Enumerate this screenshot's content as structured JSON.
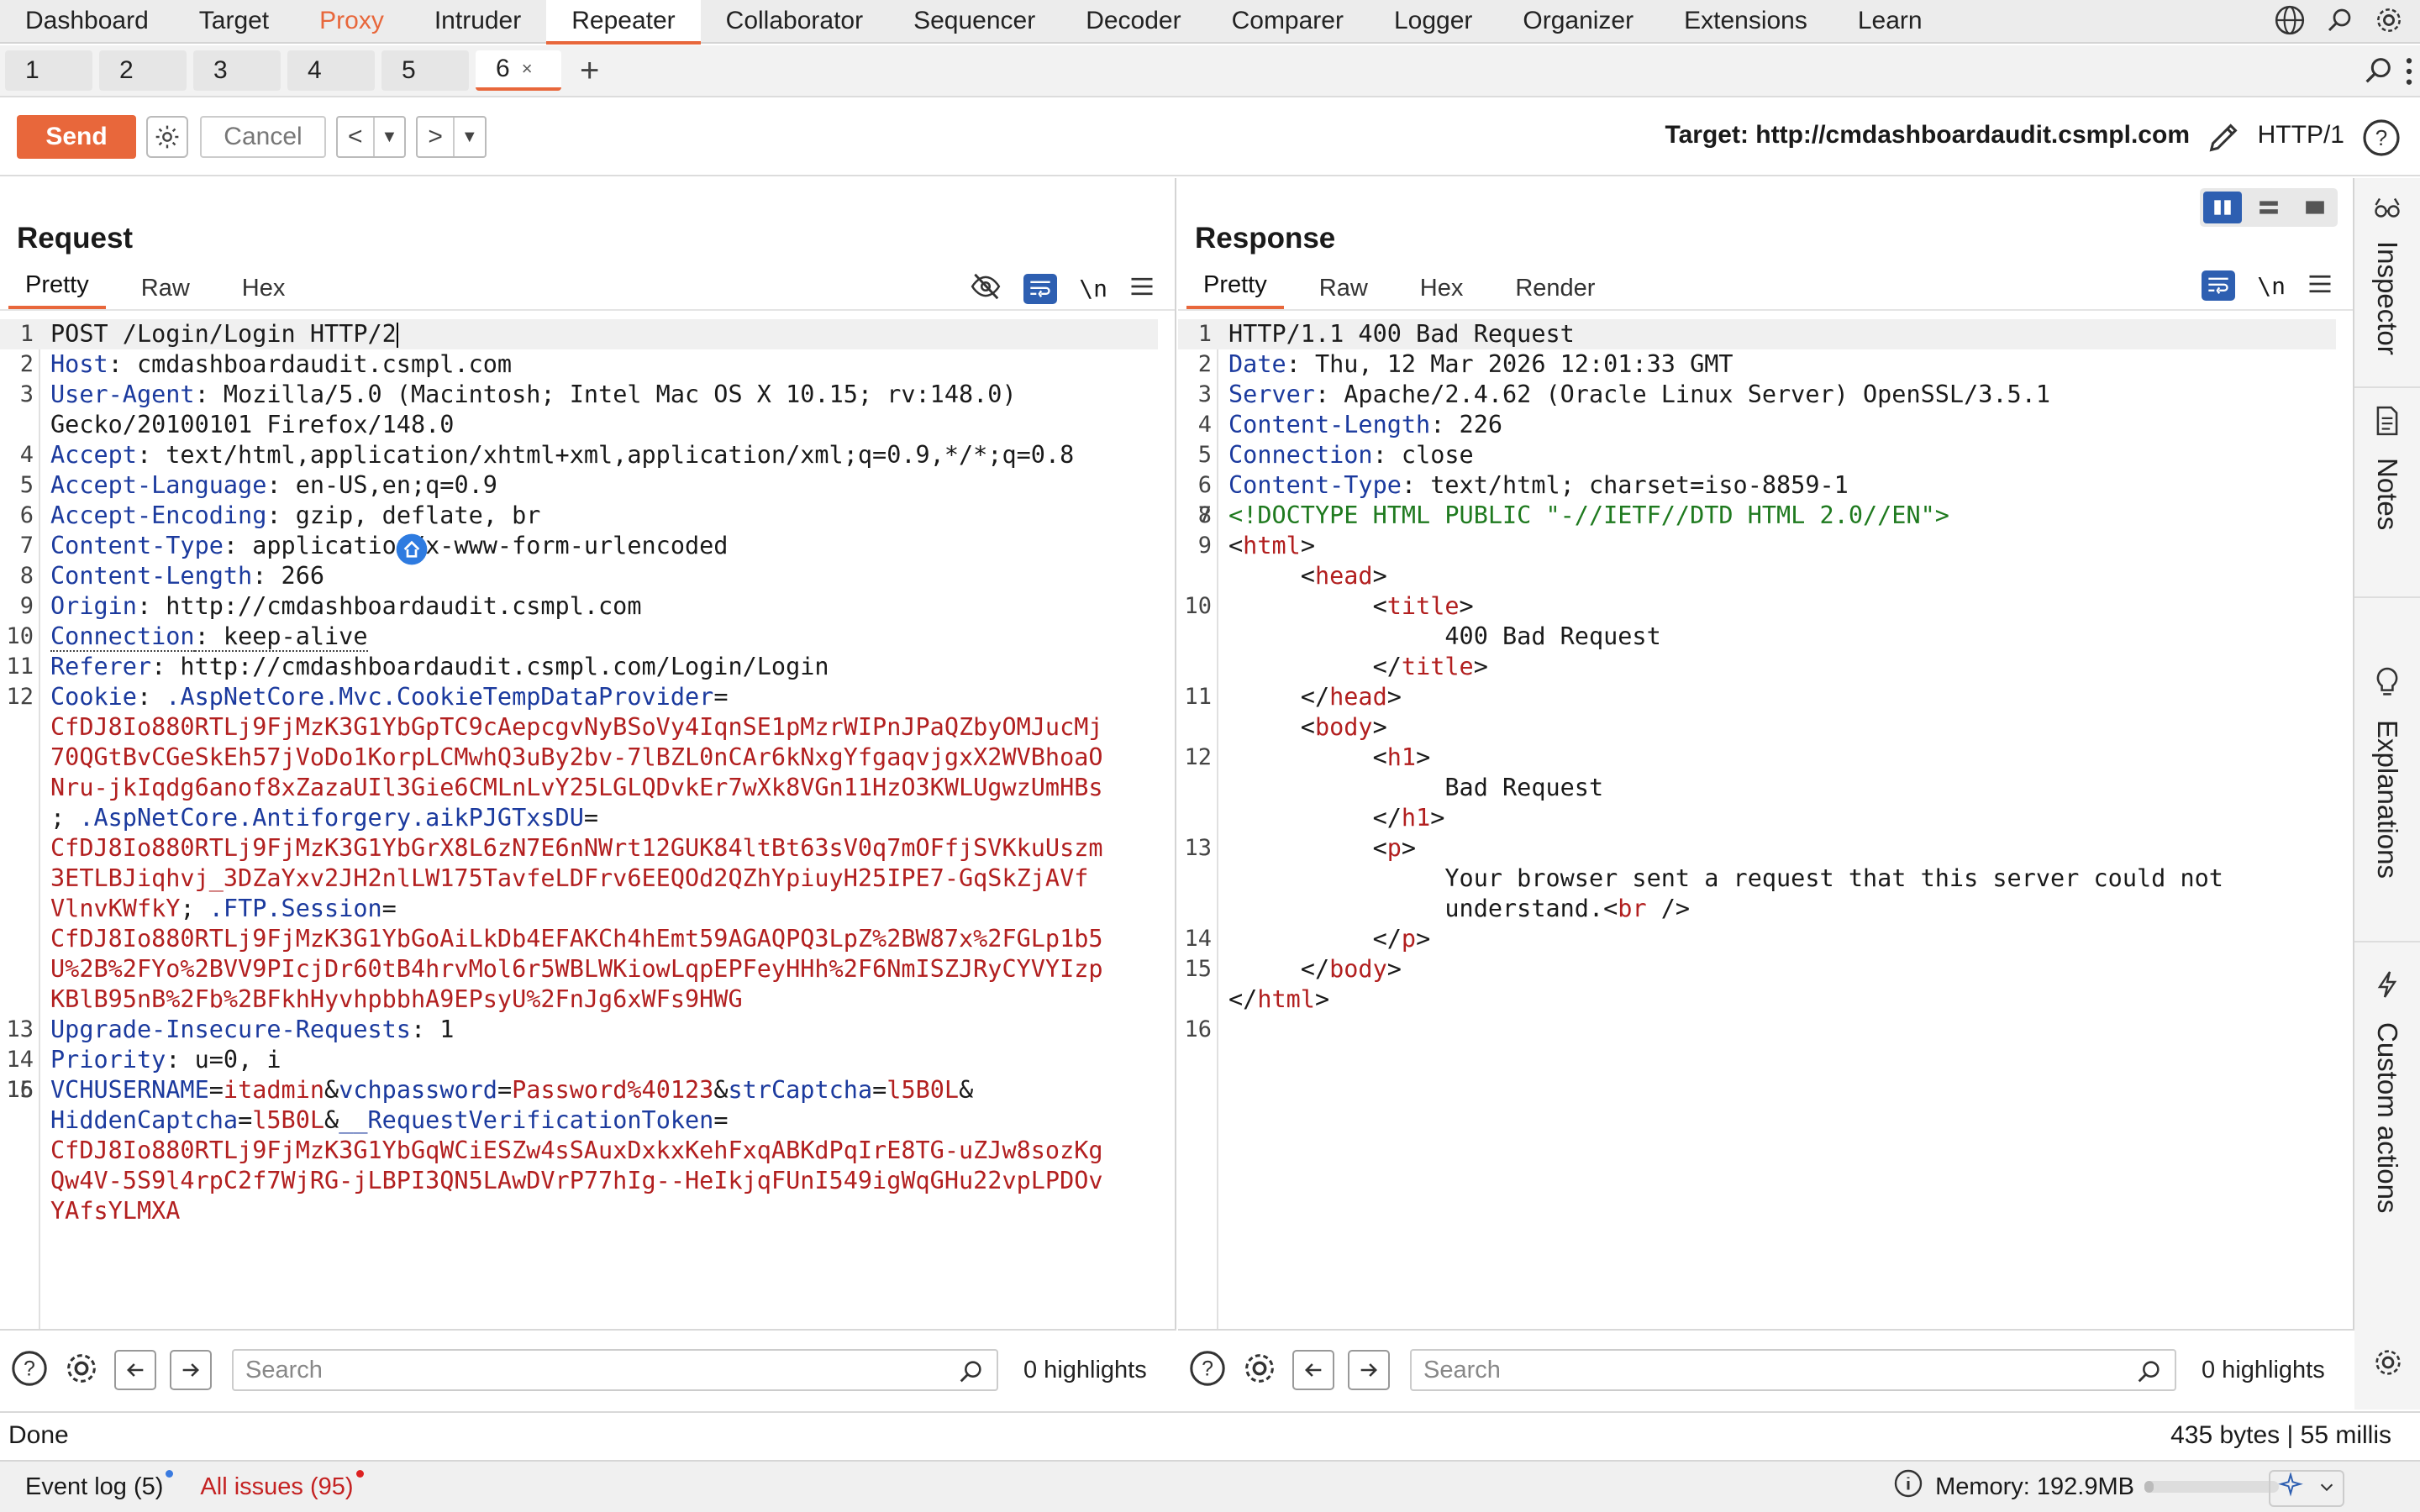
{
  "nav": {
    "tabs": [
      "Dashboard",
      "Target",
      "Proxy",
      "Intruder",
      "Repeater",
      "Collaborator",
      "Sequencer",
      "Decoder",
      "Comparer",
      "Logger",
      "Organizer",
      "Extensions",
      "Learn"
    ],
    "active": "Repeater"
  },
  "repeater_tabs": {
    "items": [
      "1",
      "2",
      "3",
      "4",
      "5",
      "6"
    ],
    "active": "6",
    "close_glyph": "×",
    "add_glyph": "+"
  },
  "toolbar": {
    "send": "Send",
    "cancel": "Cancel",
    "back": "<",
    "forward": ">",
    "target": "Target: http://cmdashboardaudit.csmpl.com",
    "protocol": "HTTP/1"
  },
  "request": {
    "title": "Request",
    "tabs": [
      "Pretty",
      "Raw",
      "Hex"
    ],
    "newline_toggle": "\\n",
    "lines": [
      {
        "n": "1",
        "segs": [
          [
            "",
            "POST /Login/Login HTTP/2"
          ]
        ]
      },
      {
        "n": "2",
        "segs": [
          [
            "hk",
            "Host"
          ],
          [
            "",
            ": cmdashboardaudit.csmpl.com"
          ]
        ]
      },
      {
        "n": "3",
        "segs": [
          [
            "hk",
            "User-Agent"
          ],
          [
            "",
            ": Mozilla/5.0 (Macintosh; Intel Mac OS X 10.15; rv:148.0)"
          ]
        ]
      },
      {
        "n": "",
        "segs": [
          [
            "",
            "Gecko/20100101 Firefox/148.0"
          ]
        ]
      },
      {
        "n": "4",
        "segs": [
          [
            "hk",
            "Accept"
          ],
          [
            "",
            ": text/html,application/xhtml+xml,application/xml;q=0.9,*/*;q=0.8"
          ]
        ]
      },
      {
        "n": "5",
        "segs": [
          [
            "hk",
            "Accept-Language"
          ],
          [
            "",
            ": en-US,en;q=0.9"
          ]
        ]
      },
      {
        "n": "6",
        "segs": [
          [
            "hk",
            "Accept-Encoding"
          ],
          [
            "",
            ": gzip, deflate, br"
          ]
        ]
      },
      {
        "n": "7",
        "segs": [
          [
            "hk",
            "Content-Type"
          ],
          [
            "",
            ": application/x-www-form-urlencoded"
          ]
        ]
      },
      {
        "n": "8",
        "segs": [
          [
            "hk",
            "Content-Length"
          ],
          [
            "",
            ": 266"
          ]
        ]
      },
      {
        "n": "9",
        "segs": [
          [
            "hk",
            "Origin"
          ],
          [
            "",
            ": http://cmdashboardaudit.csmpl.com"
          ]
        ]
      },
      {
        "n": "10",
        "segs": [
          [
            "hk dotted",
            "Connection"
          ],
          [
            "dotted",
            ": keep-alive"
          ]
        ]
      },
      {
        "n": "11",
        "segs": [
          [
            "hk",
            "Referer"
          ],
          [
            "",
            ": http://cmdashboardaudit.csmpl.com/Login/Login"
          ]
        ]
      },
      {
        "n": "12",
        "segs": [
          [
            "hk",
            "Cookie"
          ],
          [
            "",
            ": "
          ],
          [
            "blu",
            ".AspNetCore.Mvc.CookieTempDataProvider"
          ],
          [
            "",
            "="
          ]
        ]
      },
      {
        "n": "",
        "segs": [
          [
            "red",
            "CfDJ8Io880RTLj9FjMzK3G1YbGpTC9cAepcgvNyBSoVy4IqnSE1pMzrWIPnJPaQZbyOMJucMj"
          ]
        ]
      },
      {
        "n": "",
        "segs": [
          [
            "red",
            "70QGtBvCGeSkEh57jVoDo1KorpLCMwhQ3uBy2bv-7lBZL0nCAr6kNxgYfgaqvjgxX2WVBhoaO"
          ]
        ]
      },
      {
        "n": "",
        "segs": [
          [
            "red",
            "Nru-jkIqdg6anof8xZazaUIl3Gie6CMLnLvY25LGLQDvkEr7wXk8VGn11HzO3KWLUgwzUmHBs"
          ]
        ]
      },
      {
        "n": "",
        "segs": [
          [
            "",
            "; "
          ],
          [
            "blu",
            ".AspNetCore.Antiforgery.aikPJGTxsDU"
          ],
          [
            "",
            "="
          ]
        ]
      },
      {
        "n": "",
        "segs": [
          [
            "red",
            "CfDJ8Io880RTLj9FjMzK3G1YbGrX8L6zN7E6nNWrt12GUK84ltBt63sV0q7mOFfjSVKkuUszm"
          ]
        ]
      },
      {
        "n": "",
        "segs": [
          [
            "red",
            "3ETLBJiqhvj_3DZaYxv2JH2nlLW175TavfeLDFrv6EEQOd2QZhYpiuyH25IPE7-GqSkZjAVf"
          ]
        ]
      },
      {
        "n": "",
        "segs": [
          [
            "red",
            "VlnvKWfkY"
          ],
          [
            "",
            "; "
          ],
          [
            "blu",
            ".FTP.Session"
          ],
          [
            "",
            "="
          ]
        ]
      },
      {
        "n": "",
        "segs": [
          [
            "red",
            "CfDJ8Io880RTLj9FjMzK3G1YbGoAiLkDb4EFAKCh4hEmt59AGAQPQ3LpZ%2BW87x%2FGLp1b5"
          ]
        ]
      },
      {
        "n": "",
        "segs": [
          [
            "red",
            "U%2B%2FYo%2BVV9PIcjDr60tB4hrvMol6r5WBLWKiowLqpEPFeyHHh%2F6NmISZJRyCYVYIzp"
          ]
        ]
      },
      {
        "n": "",
        "segs": [
          [
            "red",
            "KBlB95nB%2Fb%2BFkhHyvhpbbhA9EPsyU%2FnJg6xWFs9HWG"
          ]
        ]
      },
      {
        "n": "13",
        "segs": [
          [
            "hk",
            "Upgrade-Insecure-Requests"
          ],
          [
            "",
            ": 1"
          ]
        ]
      },
      {
        "n": "14",
        "segs": [
          [
            "hk",
            "Priority"
          ],
          [
            "",
            ": u=0, i"
          ]
        ]
      },
      {
        "n": "15",
        "segs": [
          [
            "",
            ""
          ]
        ]
      },
      {
        "n": "16",
        "segs": [
          [
            "blu",
            "VCHUSERNAME"
          ],
          [
            "",
            "="
          ],
          [
            "red",
            "itadmin"
          ],
          [
            "",
            "&"
          ],
          [
            "blu",
            "vchpassword"
          ],
          [
            "",
            "="
          ],
          [
            "red",
            "Password%40123"
          ],
          [
            "",
            "&"
          ],
          [
            "blu",
            "strCaptcha"
          ],
          [
            "",
            "="
          ],
          [
            "red",
            "l5B0L"
          ],
          [
            "",
            "&"
          ]
        ]
      },
      {
        "n": "",
        "segs": [
          [
            "blu",
            "HiddenCaptcha"
          ],
          [
            "",
            "="
          ],
          [
            "red",
            "l5B0L"
          ],
          [
            "",
            "&"
          ],
          [
            "blu",
            "__RequestVerificationToken"
          ],
          [
            "",
            "="
          ]
        ]
      },
      {
        "n": "",
        "segs": [
          [
            "red",
            "CfDJ8Io880RTLj9FjMzK3G1YbGqWCiESZw4sSAuxDxkxKehFxqABKdPqIrE8TG-uZJw8sozKg"
          ]
        ]
      },
      {
        "n": "",
        "segs": [
          [
            "red",
            "Qw4V-5S9l4rpC2f7WjRG-jLBPI3QN5LAwDVrP77hIg--HeIkjqFUnI549igWqGHu22vpLPDOv"
          ]
        ]
      },
      {
        "n": "",
        "segs": [
          [
            "red",
            "YAfsYLMXA"
          ]
        ]
      }
    ],
    "search_placeholder": "Search",
    "highlights": "0 highlights"
  },
  "response": {
    "title": "Response",
    "tabs": [
      "Pretty",
      "Raw",
      "Hex",
      "Render"
    ],
    "newline_toggle": "\\n",
    "lines": [
      {
        "n": "1",
        "segs": [
          [
            "",
            "HTTP/1.1 400 Bad Request"
          ]
        ]
      },
      {
        "n": "2",
        "segs": [
          [
            "hk",
            "Date"
          ],
          [
            "",
            ": Thu, 12 Mar 2026 12:01:33 GMT"
          ]
        ]
      },
      {
        "n": "3",
        "segs": [
          [
            "hk",
            "Server"
          ],
          [
            "",
            ": Apache/2.4.62 (Oracle Linux Server) OpenSSL/3.5.1"
          ]
        ]
      },
      {
        "n": "4",
        "segs": [
          [
            "hk",
            "Content-Length"
          ],
          [
            "",
            ": 226"
          ]
        ]
      },
      {
        "n": "5",
        "segs": [
          [
            "hk",
            "Connection"
          ],
          [
            "",
            ": close"
          ]
        ]
      },
      {
        "n": "6",
        "segs": [
          [
            "hk",
            "Content-Type"
          ],
          [
            "",
            ": text/html; charset=iso-8859-1"
          ]
        ]
      },
      {
        "n": "7",
        "segs": [
          [
            "",
            ""
          ]
        ]
      },
      {
        "n": "8",
        "segs": [
          [
            "grn",
            "<!DOCTYPE HTML PUBLIC \"-//IETF//DTD HTML 2.0//EN\">"
          ]
        ]
      },
      {
        "n": "9",
        "segs": [
          [
            "",
            "<"
          ],
          [
            "tag",
            "html"
          ],
          [
            "",
            ">"
          ]
        ]
      },
      {
        "n": "",
        "segs": [
          [
            "",
            "     <"
          ],
          [
            "tag",
            "head"
          ],
          [
            "",
            ">"
          ]
        ]
      },
      {
        "n": "10",
        "segs": [
          [
            "",
            "          <"
          ],
          [
            "tag",
            "title"
          ],
          [
            "",
            ">"
          ]
        ]
      },
      {
        "n": "",
        "segs": [
          [
            "",
            "               400 Bad Request"
          ]
        ]
      },
      {
        "n": "",
        "segs": [
          [
            "",
            "          </"
          ],
          [
            "tag",
            "title"
          ],
          [
            "",
            ">"
          ]
        ]
      },
      {
        "n": "11",
        "segs": [
          [
            "",
            "     </"
          ],
          [
            "tag",
            "head"
          ],
          [
            "",
            ">"
          ]
        ]
      },
      {
        "n": "",
        "segs": [
          [
            "",
            "     <"
          ],
          [
            "tag",
            "body"
          ],
          [
            "",
            ">"
          ]
        ]
      },
      {
        "n": "12",
        "segs": [
          [
            "",
            "          <"
          ],
          [
            "tag",
            "h1"
          ],
          [
            "",
            ">"
          ]
        ]
      },
      {
        "n": "",
        "segs": [
          [
            "",
            "               Bad Request"
          ]
        ]
      },
      {
        "n": "",
        "segs": [
          [
            "",
            "          </"
          ],
          [
            "tag",
            "h1"
          ],
          [
            "",
            ">"
          ]
        ]
      },
      {
        "n": "13",
        "segs": [
          [
            "",
            "          <"
          ],
          [
            "tag",
            "p"
          ],
          [
            "",
            ">"
          ]
        ]
      },
      {
        "n": "",
        "segs": [
          [
            "",
            "               Your browser sent a request that this server could not"
          ]
        ]
      },
      {
        "n": "",
        "segs": [
          [
            "",
            "               understand.<"
          ],
          [
            "tag",
            "br"
          ],
          [
            "",
            " />"
          ]
        ]
      },
      {
        "n": "14",
        "segs": [
          [
            "",
            "          </"
          ],
          [
            "tag",
            "p"
          ],
          [
            "",
            ">"
          ]
        ]
      },
      {
        "n": "15",
        "segs": [
          [
            "",
            "     </"
          ],
          [
            "tag",
            "body"
          ],
          [
            "",
            ">"
          ]
        ]
      },
      {
        "n": "",
        "segs": [
          [
            "",
            "</"
          ],
          [
            "tag",
            "html"
          ],
          [
            "",
            ">"
          ]
        ]
      },
      {
        "n": "16",
        "segs": [
          [
            "",
            ""
          ]
        ]
      }
    ],
    "search_placeholder": "Search",
    "highlights": "0 highlights"
  },
  "sidebar": [
    "Inspector",
    "Notes",
    "Explanations",
    "Custom actions"
  ],
  "status": {
    "left": "Done",
    "right": "435 bytes | 55 millis"
  },
  "footer": {
    "event_log": "Event log (5)",
    "issues": "All issues (95)",
    "memory": "Memory: 192.9MB",
    "memory_fraction": 0.07
  },
  "colors": {
    "accent": "#e8673b",
    "header_key": "#1b3a9e",
    "value_red": "#b21f1f",
    "doctype_green": "#1f7a1f",
    "toggle_blue": "#2e5fb1"
  }
}
